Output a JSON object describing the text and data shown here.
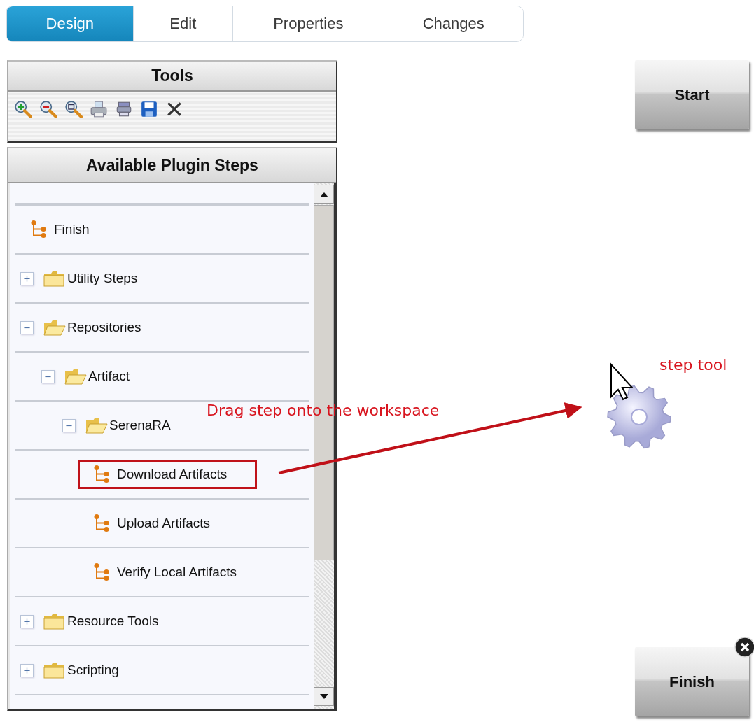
{
  "tabs": [
    {
      "label": "Design",
      "selected": true
    },
    {
      "label": "Edit",
      "selected": false
    },
    {
      "label": "Properties",
      "selected": false
    },
    {
      "label": "Changes",
      "selected": false
    }
  ],
  "tools_panel": {
    "title": "Tools"
  },
  "plugin_steps": {
    "title": "Available Plugin Steps",
    "items": [
      {
        "kind": "step",
        "label": "Finish",
        "highlighted": false
      },
      {
        "kind": "folder",
        "label": "Utility Steps",
        "expanded": false
      },
      {
        "kind": "folder",
        "label": "Repositories",
        "expanded": true,
        "children": [
          {
            "kind": "folder",
            "label": "Artifact",
            "expanded": true,
            "children": [
              {
                "kind": "folder",
                "label": "SerenaRA",
                "expanded": true,
                "children": [
                  {
                    "kind": "step",
                    "label": "Download Artifacts",
                    "highlighted": true
                  },
                  {
                    "kind": "step",
                    "label": "Upload Artifacts",
                    "highlighted": false
                  },
                  {
                    "kind": "step",
                    "label": "Verify Local Artifacts",
                    "highlighted": false
                  }
                ]
              }
            ]
          }
        ]
      },
      {
        "kind": "folder",
        "label": "Resource Tools",
        "expanded": false
      },
      {
        "kind": "folder",
        "label": "Scripting",
        "expanded": false
      }
    ]
  },
  "canvas": {
    "nodes": [
      {
        "label": "Start",
        "removable": false
      },
      {
        "label": "Finish",
        "removable": true
      }
    ],
    "callout": "Drag step onto the workspace",
    "hint": "step tool"
  }
}
